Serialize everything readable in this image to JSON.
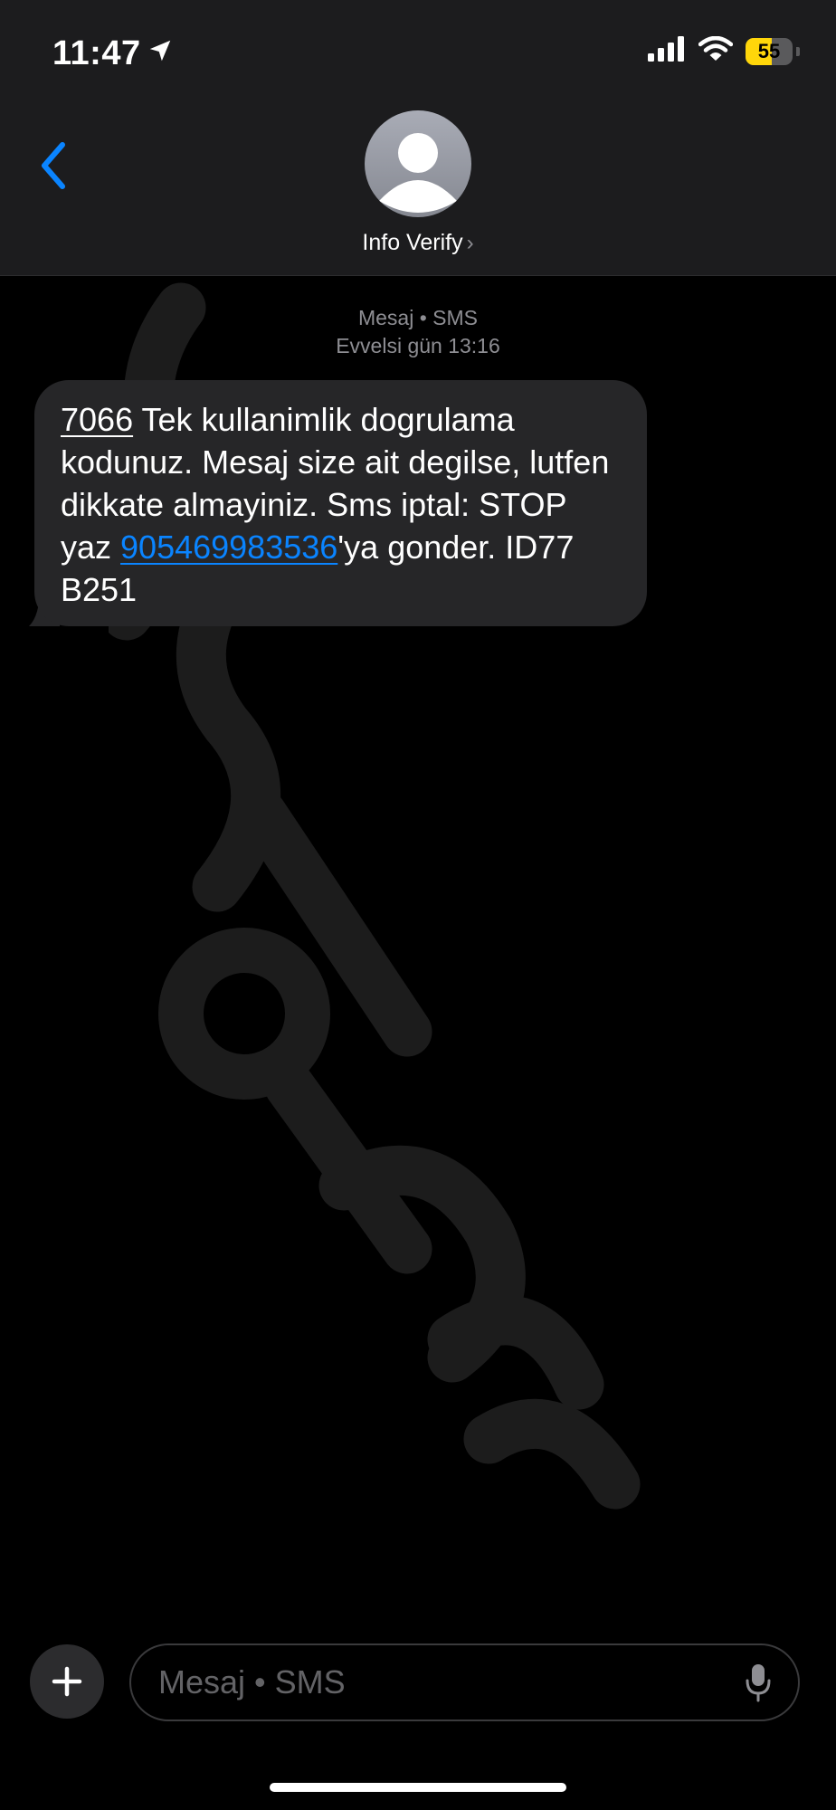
{
  "status": {
    "time": "11:47",
    "battery": "55",
    "battery_level": 0.55
  },
  "header": {
    "contact_name": "Info Verify"
  },
  "thread": {
    "meta_line1": "Mesaj • SMS",
    "meta_line2": "Evvelsi gün 13:16",
    "message": {
      "code": "7066",
      "text1": " Tek kullanimlik dogrulama kodunuz. Mesaj size ait degilse, lutfen dikkate almayiniz. Sms iptal: STOP yaz ",
      "phone": "905469983536",
      "text2": "'ya gonder. ID77 B251"
    }
  },
  "compose": {
    "placeholder": "Mesaj • SMS"
  },
  "colors": {
    "accent": "#0a84ff",
    "bubble": "#262628",
    "header": "#1c1c1e",
    "battery": "#ffd60a"
  }
}
